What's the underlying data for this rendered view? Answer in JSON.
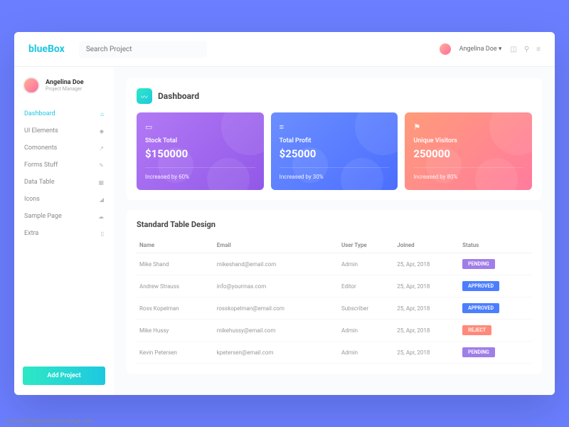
{
  "brand": {
    "blue": "blue",
    "box": "Box"
  },
  "search": {
    "placeholder": "Search Project"
  },
  "user": {
    "name": "Angelina Doe",
    "dropdown": "▾"
  },
  "profile": {
    "name": "Angelina Doe",
    "role": "Project Manager"
  },
  "sidebar": {
    "items": [
      {
        "label": "Dashboard",
        "icon": "⌂",
        "active": true
      },
      {
        "label": "UI Elements",
        "icon": "◆"
      },
      {
        "label": "Comonents",
        "icon": "↗"
      },
      {
        "label": "Forms Stuff",
        "icon": "✎"
      },
      {
        "label": "Data Table",
        "icon": "▦"
      },
      {
        "label": "Icons",
        "icon": "◢"
      },
      {
        "label": "Sample Page",
        "icon": "☁"
      },
      {
        "label": "Extra",
        "icon": "▯"
      }
    ],
    "add_btn": "Add Project"
  },
  "page": {
    "title": "Dashboard"
  },
  "cards": [
    {
      "label": "Stock Total",
      "value": "$150000",
      "sub": "Increased by 60%",
      "icon": "▭"
    },
    {
      "label": "Total Profit",
      "value": "$25000",
      "sub": "Increased by 30%",
      "icon": "≡"
    },
    {
      "label": "Unique Visitors",
      "value": "250000",
      "sub": "Increased by 80%",
      "icon": "⚑"
    }
  ],
  "table": {
    "title": "Standard Table Design",
    "headers": [
      "Name",
      "Email",
      "User Type",
      "Joined",
      "Status"
    ],
    "rows": [
      {
        "name": "Mike Shand",
        "email": "mikeshand@email.com",
        "type": "Admin",
        "joined": "25, Apr, 2018",
        "status": "PENDING",
        "statusClass": "pending"
      },
      {
        "name": "Andrew Strauss",
        "email": "info@yourmax.com",
        "type": "Editor",
        "joined": "25, Apr, 2018",
        "status": "APPROVED",
        "statusClass": "approved"
      },
      {
        "name": "Ross Kopelman",
        "email": "rosskopelman@email.com",
        "type": "Subscriber",
        "joined": "25, Apr, 2018",
        "status": "APPROVED",
        "statusClass": "approved"
      },
      {
        "name": "Mike Hussy",
        "email": "mikehussy@email.com",
        "type": "Admin",
        "joined": "25, Apr, 2018",
        "status": "REJECT",
        "statusClass": "reject"
      },
      {
        "name": "Kevin Petersen",
        "email": "kpetersen@email.com",
        "type": "Admin",
        "joined": "25, Apr, 2018",
        "status": "PENDING",
        "statusClass": "pending"
      }
    ]
  },
  "watermark": "www.heritagechristiancollege.com"
}
